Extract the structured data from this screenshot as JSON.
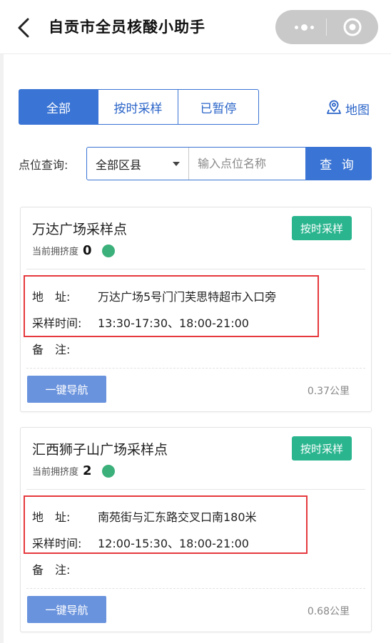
{
  "header": {
    "title": "自贡市全员核酸小助手"
  },
  "tabs": [
    {
      "label": "全部",
      "active": true
    },
    {
      "label": "按时采样",
      "active": false
    },
    {
      "label": "已暂停",
      "active": false
    }
  ],
  "map_link": {
    "label": "地图"
  },
  "search": {
    "label": "点位查询:",
    "district_value": "全部区县",
    "name_placeholder": "输入点位名称",
    "query_label": "查 询"
  },
  "sites": [
    {
      "name": "万达广场采样点",
      "status_badge": "按时采样",
      "crowd_label": "当前拥挤度",
      "crowd_value": "0",
      "address_label": "地　址:",
      "address": "万达广场5号门门芙思特超市入口旁",
      "time_label": "采样时间:",
      "time": "13:30-17:30、18:00-21:00",
      "remark_label": "备　注:",
      "remark": "",
      "nav_label": "一键导航",
      "distance": "0.37公里"
    },
    {
      "name": "汇西狮子山广场采样点",
      "status_badge": "按时采样",
      "crowd_label": "当前拥挤度",
      "crowd_value": "2",
      "address_label": "地　址:",
      "address": "南苑街与汇东路交叉口南180米",
      "time_label": "采样时间:",
      "time": "12:00-15:30、18:00-21:00",
      "remark_label": "备　注:",
      "remark": "",
      "nav_label": "一键导航",
      "distance": "0.68公里"
    }
  ],
  "colors": {
    "primary": "#3a74d4",
    "badge": "#2ab58f",
    "crowd_dot": "#3bb07a",
    "highlight": "#e5393d",
    "nav_button": "#6a93dd"
  }
}
